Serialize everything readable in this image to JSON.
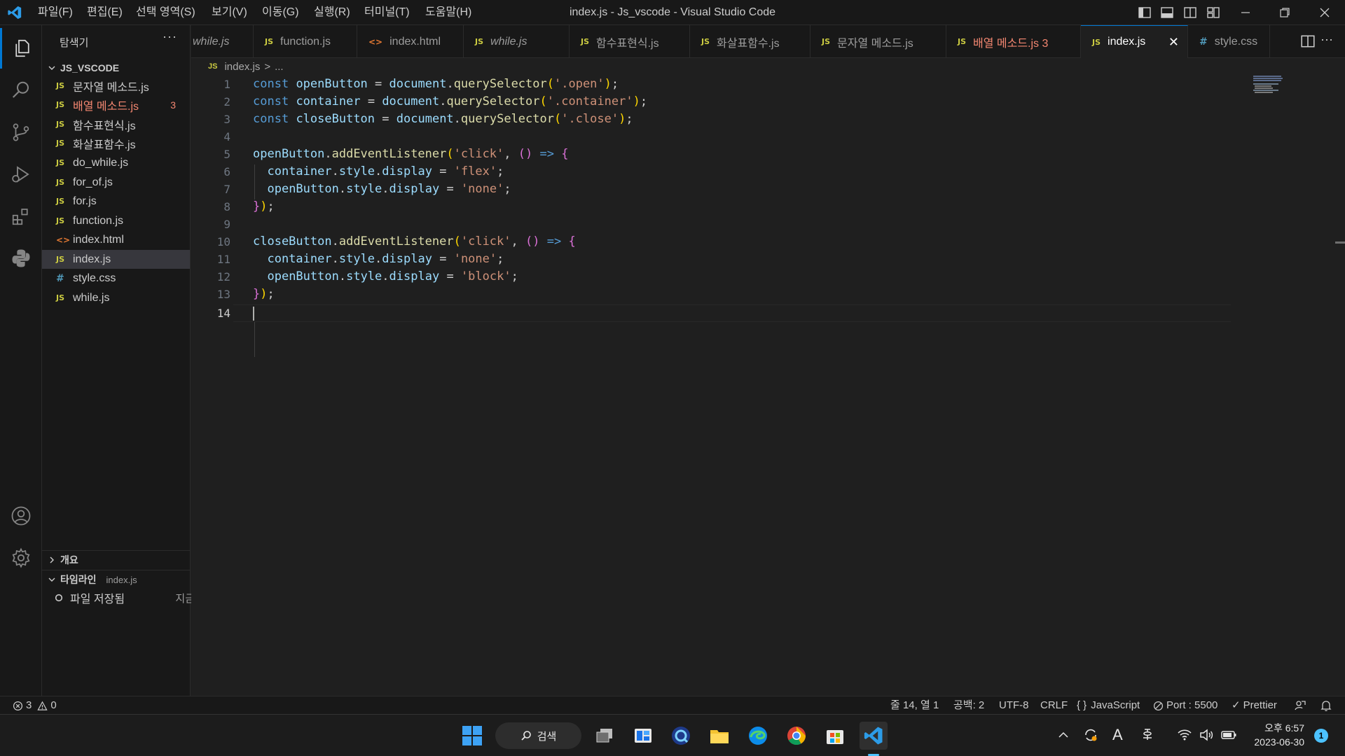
{
  "titlebar": {
    "menus": [
      "파일(F)",
      "편집(E)",
      "선택 영역(S)",
      "보기(V)",
      "이동(G)",
      "실행(R)",
      "터미널(T)",
      "도움말(H)"
    ],
    "window_title": "index.js - Js_vscode - Visual Studio Code"
  },
  "sidebar": {
    "title": "탐색기",
    "more": "···",
    "folder": "JS_VSCODE",
    "files": [
      {
        "name": "문자열 메소드.js",
        "icon": "JS",
        "badge": ""
      },
      {
        "name": "배열 메소드.js",
        "icon": "JS",
        "badge": "3"
      },
      {
        "name": "함수표현식.js",
        "icon": "JS",
        "badge": ""
      },
      {
        "name": "화살표함수.js",
        "icon": "JS",
        "badge": ""
      },
      {
        "name": "do_while.js",
        "icon": "JS",
        "badge": ""
      },
      {
        "name": "for_of.js",
        "icon": "JS",
        "badge": ""
      },
      {
        "name": "for.js",
        "icon": "JS",
        "badge": ""
      },
      {
        "name": "function.js",
        "icon": "JS",
        "badge": ""
      },
      {
        "name": "index.html",
        "icon": "<>",
        "badge": ""
      },
      {
        "name": "index.js",
        "icon": "JS",
        "badge": ""
      },
      {
        "name": "style.css",
        "icon": "#",
        "badge": ""
      },
      {
        "name": "while.js",
        "icon": "JS",
        "badge": ""
      }
    ],
    "outline_label": "개요",
    "timeline_label": "타임라인",
    "timeline_file": "index.js",
    "timeline_entry": "파일 저장됨",
    "timeline_when": "지금"
  },
  "tabs": [
    {
      "label": "while.js",
      "icon": ""
    },
    {
      "label": "function.js",
      "icon": "JS"
    },
    {
      "label": "index.html",
      "icon": "<>"
    },
    {
      "label": "while.js",
      "icon": "JS"
    },
    {
      "label": "함수표현식.js",
      "icon": "JS"
    },
    {
      "label": "화살표함수.js",
      "icon": "JS"
    },
    {
      "label": "문자열 메소드.js",
      "icon": "JS"
    },
    {
      "label": "배열 메소드.js 3",
      "icon": "JS"
    },
    {
      "label": "index.js",
      "icon": "JS"
    },
    {
      "label": "style.css",
      "icon": "#"
    }
  ],
  "breadcrumb": {
    "icon": "JS",
    "file": "index.js",
    "sep": ">",
    "rest": "..."
  },
  "editor": {
    "line_numbers": [
      "1",
      "2",
      "3",
      "4",
      "5",
      "6",
      "7",
      "8",
      "9",
      "10",
      "11",
      "12",
      "13",
      "14"
    ]
  },
  "statusbar": {
    "errors": "3",
    "warnings": "0",
    "position": "줄 14, 열 1",
    "indent": "공백: 2",
    "encoding": "UTF-8",
    "eol": "CRLF",
    "language": "JavaScript",
    "port": "Port : 5500",
    "formatter": "Prettier"
  },
  "taskbar": {
    "search_label": "검색",
    "time": "오후 6:57",
    "date": "2023-06-30",
    "notification_count": "1"
  }
}
